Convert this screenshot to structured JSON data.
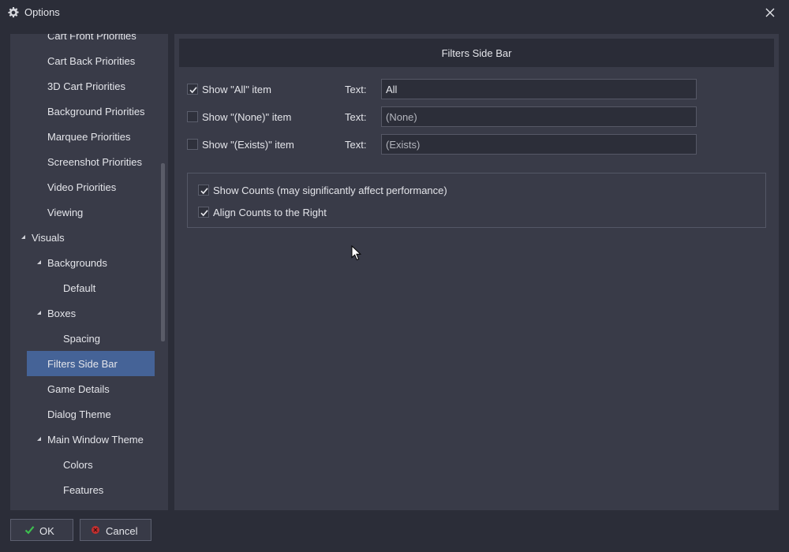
{
  "window": {
    "title": "Options",
    "icon": "gear-icon",
    "close_icon": "close-icon"
  },
  "tree": {
    "items": [
      {
        "label": "Cart Front Priorities",
        "level": 1,
        "expander": false
      },
      {
        "label": "Cart Back Priorities",
        "level": 1,
        "expander": false
      },
      {
        "label": "3D Cart Priorities",
        "level": 1,
        "expander": false
      },
      {
        "label": "Background Priorities",
        "level": 1,
        "expander": false
      },
      {
        "label": "Marquee Priorities",
        "level": 1,
        "expander": false
      },
      {
        "label": "Screenshot Priorities",
        "level": 1,
        "expander": false
      },
      {
        "label": "Video Priorities",
        "level": 1,
        "expander": false
      },
      {
        "label": "Viewing",
        "level": 1,
        "expander": false
      },
      {
        "label": "Visuals",
        "level": 0,
        "expander": true
      },
      {
        "label": "Backgrounds",
        "level": 1,
        "expander": true
      },
      {
        "label": "Default",
        "level": 2,
        "expander": false
      },
      {
        "label": "Boxes",
        "level": 1,
        "expander": true
      },
      {
        "label": "Spacing",
        "level": 2,
        "expander": false
      },
      {
        "label": "Filters Side Bar",
        "level": 1,
        "expander": false,
        "selected": true
      },
      {
        "label": "Game Details",
        "level": 1,
        "expander": false
      },
      {
        "label": "Dialog Theme",
        "level": 1,
        "expander": false
      },
      {
        "label": "Main Window Theme",
        "level": 1,
        "expander": true
      },
      {
        "label": "Colors",
        "level": 2,
        "expander": false
      },
      {
        "label": "Features",
        "level": 2,
        "expander": false
      }
    ]
  },
  "panel": {
    "header": "Filters Side Bar",
    "rows": [
      {
        "checkbox_label": "Show \"All\" item",
        "checked": true,
        "text_label": "Text:",
        "text_value": "All"
      },
      {
        "checkbox_label": "Show \"(None)\" item",
        "checked": false,
        "text_label": "Text:",
        "text_value": "(None)"
      },
      {
        "checkbox_label": "Show \"(Exists)\" item",
        "checked": false,
        "text_label": "Text:",
        "text_value": "(Exists)"
      }
    ],
    "options": [
      {
        "label": "Show Counts (may significantly affect performance)",
        "checked": true
      },
      {
        "label": "Align Counts to the Right",
        "checked": true
      }
    ]
  },
  "buttons": {
    "ok": {
      "label": "OK",
      "icon": "checkmark-icon",
      "icon_color": "#3dbf4f"
    },
    "cancel": {
      "label": "Cancel",
      "icon": "cancel-icon",
      "icon_color": "#d93636"
    }
  },
  "colors": {
    "selected": "#456397",
    "background": "#2b2d38",
    "panel": "#393b48"
  }
}
